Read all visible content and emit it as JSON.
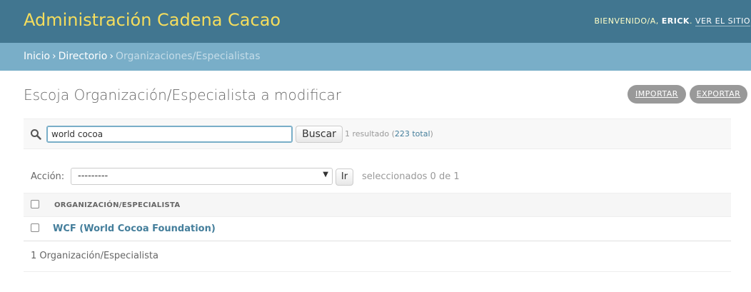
{
  "header": {
    "site_title": "Administración Cadena Cacao",
    "welcome": "Bienvenido/a,",
    "username": "Erick",
    "view_site": "Ver el sitio"
  },
  "breadcrumbs": {
    "home": "Inicio",
    "directory": "Directorio",
    "current": "Organizaciones/Especialistas",
    "separator": "›"
  },
  "content": {
    "title": "Escoja Organización/Especialista a modificar",
    "import_label": "Importar",
    "export_label": "Exportar"
  },
  "search": {
    "value": "world cocoa",
    "button_label": "Buscar",
    "result_text": "1 resultado (",
    "total_link": "223 total",
    "result_close": ")"
  },
  "actions": {
    "label": "Acción:",
    "selected_option": "---------",
    "go_label": "Ir",
    "counter": "seleccionados 0 de 1"
  },
  "table": {
    "column_header": "ORGANIZACIÓN/ESPECIALISTA",
    "rows": [
      {
        "label": "WCF (World Cocoa Foundation)"
      }
    ]
  },
  "paginator": {
    "text": "1 Organización/Especialista"
  },
  "colors": {
    "header_bg": "#417690",
    "breadcrumbs_bg": "#79aec8",
    "brand_yellow": "#f5dd5d",
    "link": "#447e9b",
    "tool_button": "#999999"
  },
  "icons": {
    "search": "search-icon",
    "select_arrow": "caret-down-icon"
  }
}
